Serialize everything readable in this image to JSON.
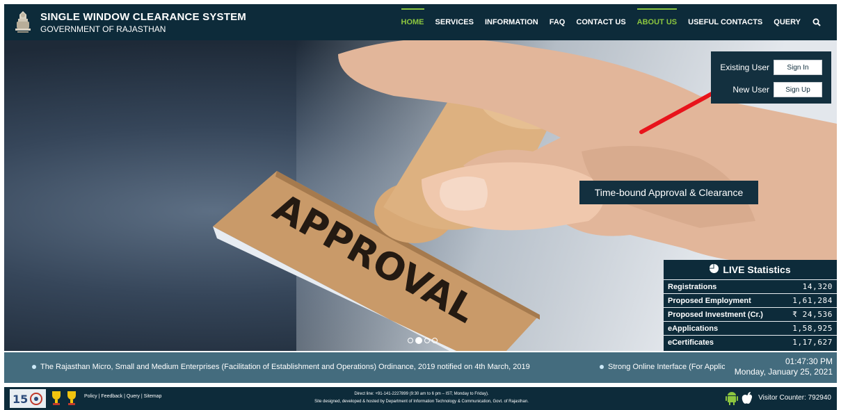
{
  "header": {
    "title": "SINGLE WINDOW CLEARANCE SYSTEM",
    "subtitle": "GOVERNMENT OF RAJASTHAN",
    "nav": [
      {
        "label": "HOME",
        "state": "active"
      },
      {
        "label": "SERVICES",
        "state": ""
      },
      {
        "label": "INFORMATION",
        "state": ""
      },
      {
        "label": "FAQ",
        "state": ""
      },
      {
        "label": "CONTACT US",
        "state": ""
      },
      {
        "label": "ABOUT US",
        "state": "highlight"
      },
      {
        "label": "USEFUL CONTACTS",
        "state": ""
      },
      {
        "label": "QUERY",
        "state": ""
      }
    ],
    "search_icon": "search-icon"
  },
  "auth": {
    "existing_label": "Existing User",
    "signin_label": "Sign In",
    "new_label": "New User",
    "signup_label": "Sign Up"
  },
  "hero": {
    "stamp_text": "APPROVAL",
    "caption": "Time-bound Approval & Clearance",
    "slides": 4,
    "active_slide": 2
  },
  "stats": {
    "title": "LIVE Statistics",
    "rows": [
      {
        "label": "Registrations",
        "value": "14,320"
      },
      {
        "label": "Proposed Employment",
        "value": "1,61,284"
      },
      {
        "label": "Proposed Investment (Cr.)",
        "value": "₹ 24,536"
      },
      {
        "label": "eApplications",
        "value": "1,58,925"
      },
      {
        "label": "eCertificates",
        "value": "1,17,627"
      }
    ]
  },
  "ticker": {
    "item1": "The Rajasthan Micro, Small and Medium Enterprises (Facilitation of Establishment and Operations) Ordinance, 2019 notified on 4th March, 2019",
    "item2": "Strong Online Interface (For Applic",
    "time": "01:47:30 PM",
    "date": "Monday, January 25, 2021"
  },
  "footer": {
    "links": [
      "Policy",
      "Feedback",
      "Query",
      "Sitemap"
    ],
    "direct_line": "Direct line: +91-141-2227899 (9:30 am to 6 pm – IST; Monday to Friday).",
    "credit": "Site designed, developed & hosted by Department of Information Technology & Communication, Govt. of Rajasthan.",
    "visitor": "Visitor Counter: 792940"
  },
  "colors": {
    "header_bg": "#0d2b3a",
    "accent_green": "#8cc63f",
    "ticker_bg": "#446c7e",
    "arrow": "#e8141b"
  }
}
